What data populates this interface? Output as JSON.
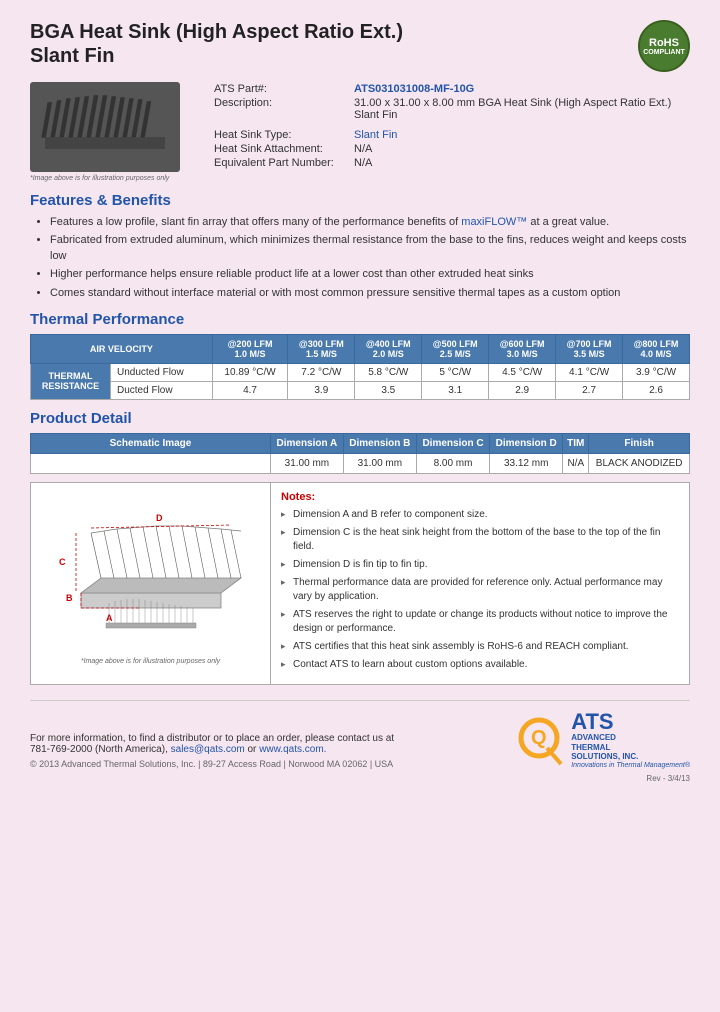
{
  "header": {
    "title_line1": "BGA Heat Sink (High Aspect Ratio Ext.)",
    "title_line2": "Slant Fin",
    "rohs": "RoHS\nCOMPLIANT"
  },
  "specs": {
    "part_label": "ATS Part#:",
    "part_number": "ATS031031008-MF-10G",
    "description_label": "Description:",
    "description_value": "31.00 x 31.00 x 8.00 mm  BGA Heat Sink (High Aspect Ratio Ext.) Slant Fin",
    "heat_sink_type_label": "Heat Sink Type:",
    "heat_sink_type_value": "Slant Fin",
    "attachment_label": "Heat Sink Attachment:",
    "attachment_value": "N/A",
    "equiv_part_label": "Equivalent Part Number:",
    "equiv_part_value": "N/A"
  },
  "image_caption": "*Image above is for illustration purposes only",
  "features": {
    "title": "Features & Benefits",
    "items": [
      "Features a low profile, slant fin array that offers many of the performance benefits of maxiFLOW™ at a great value.",
      "Fabricated from extruded aluminum, which minimizes thermal resistance from the base to the fins, reduces weight and keeps costs low",
      "Higher performance helps ensure reliable product life at a lower cost than other extruded heat sinks",
      "Comes standard without interface material or with most common pressure sensitive thermal tapes as a custom option"
    ],
    "maxiflow_label": "maxiFLOW™"
  },
  "thermal_performance": {
    "title": "Thermal Performance",
    "header_row": {
      "col0": "AIR VELOCITY",
      "col1": "@200 LFM\n1.0 M/S",
      "col2": "@300 LFM\n1.5 M/S",
      "col3": "@400 LFM\n2.0 M/S",
      "col4": "@500 LFM\n2.5 M/S",
      "col5": "@600 LFM\n3.0 M/S",
      "col6": "@700 LFM\n3.5 M/S",
      "col7": "@800 LFM\n4.0 M/S"
    },
    "row_label": "THERMAL RESISTANCE",
    "rows": [
      {
        "label": "Unducted Flow",
        "values": [
          "10.89 °C/W",
          "7.2 °C/W",
          "5.8 °C/W",
          "5 °C/W",
          "4.5 °C/W",
          "4.1 °C/W",
          "3.9 °C/W"
        ]
      },
      {
        "label": "Ducted Flow",
        "values": [
          "4.7",
          "3.9",
          "3.5",
          "3.1",
          "2.9",
          "2.7",
          "2.6"
        ]
      }
    ]
  },
  "product_detail": {
    "title": "Product Detail",
    "schematic_label": "Schematic Image",
    "columns": [
      "Dimension A",
      "Dimension B",
      "Dimension C",
      "Dimension D",
      "TIM",
      "Finish"
    ],
    "values": [
      "31.00 mm",
      "31.00 mm",
      "8.00 mm",
      "33.12 mm",
      "N/A",
      "BLACK ANODIZED"
    ],
    "schematic_caption": "*Image above is for illustration purposes only",
    "notes_label": "Notes:",
    "notes": [
      "Dimension A and B refer to component size.",
      "Dimension C is the heat sink height from the bottom of the base to the top of the fin field.",
      "Dimension D is fin tip to fin tip.",
      "Thermal performance data are provided for reference only. Actual performance may vary by application.",
      "ATS reserves the right to update or change its products without notice to improve the design or performance.",
      "ATS certifies that this heat sink assembly is RoHS-6 and REACH compliant.",
      "Contact ATS to learn about custom options available."
    ]
  },
  "footer": {
    "contact_text": "For more information, to find a distributor or to place an order, please contact us at",
    "phone": "781-769-2000 (North America),",
    "email": "sales@qats.com",
    "or_text": "or",
    "website": "www.qats.com.",
    "copyright": "© 2013 Advanced Thermal Solutions, Inc.  |  89-27 Access Road  |  Norwood MA  02062  |  USA",
    "page_number": "Rev - 3/4/13"
  },
  "logo": {
    "q_symbol": "Q",
    "ats_big": "ATS",
    "ats_full": "ADVANCED\nTHERMAL\nSOLUTIONS, INC.",
    "tagline": "Innovations in Thermal Management®"
  }
}
